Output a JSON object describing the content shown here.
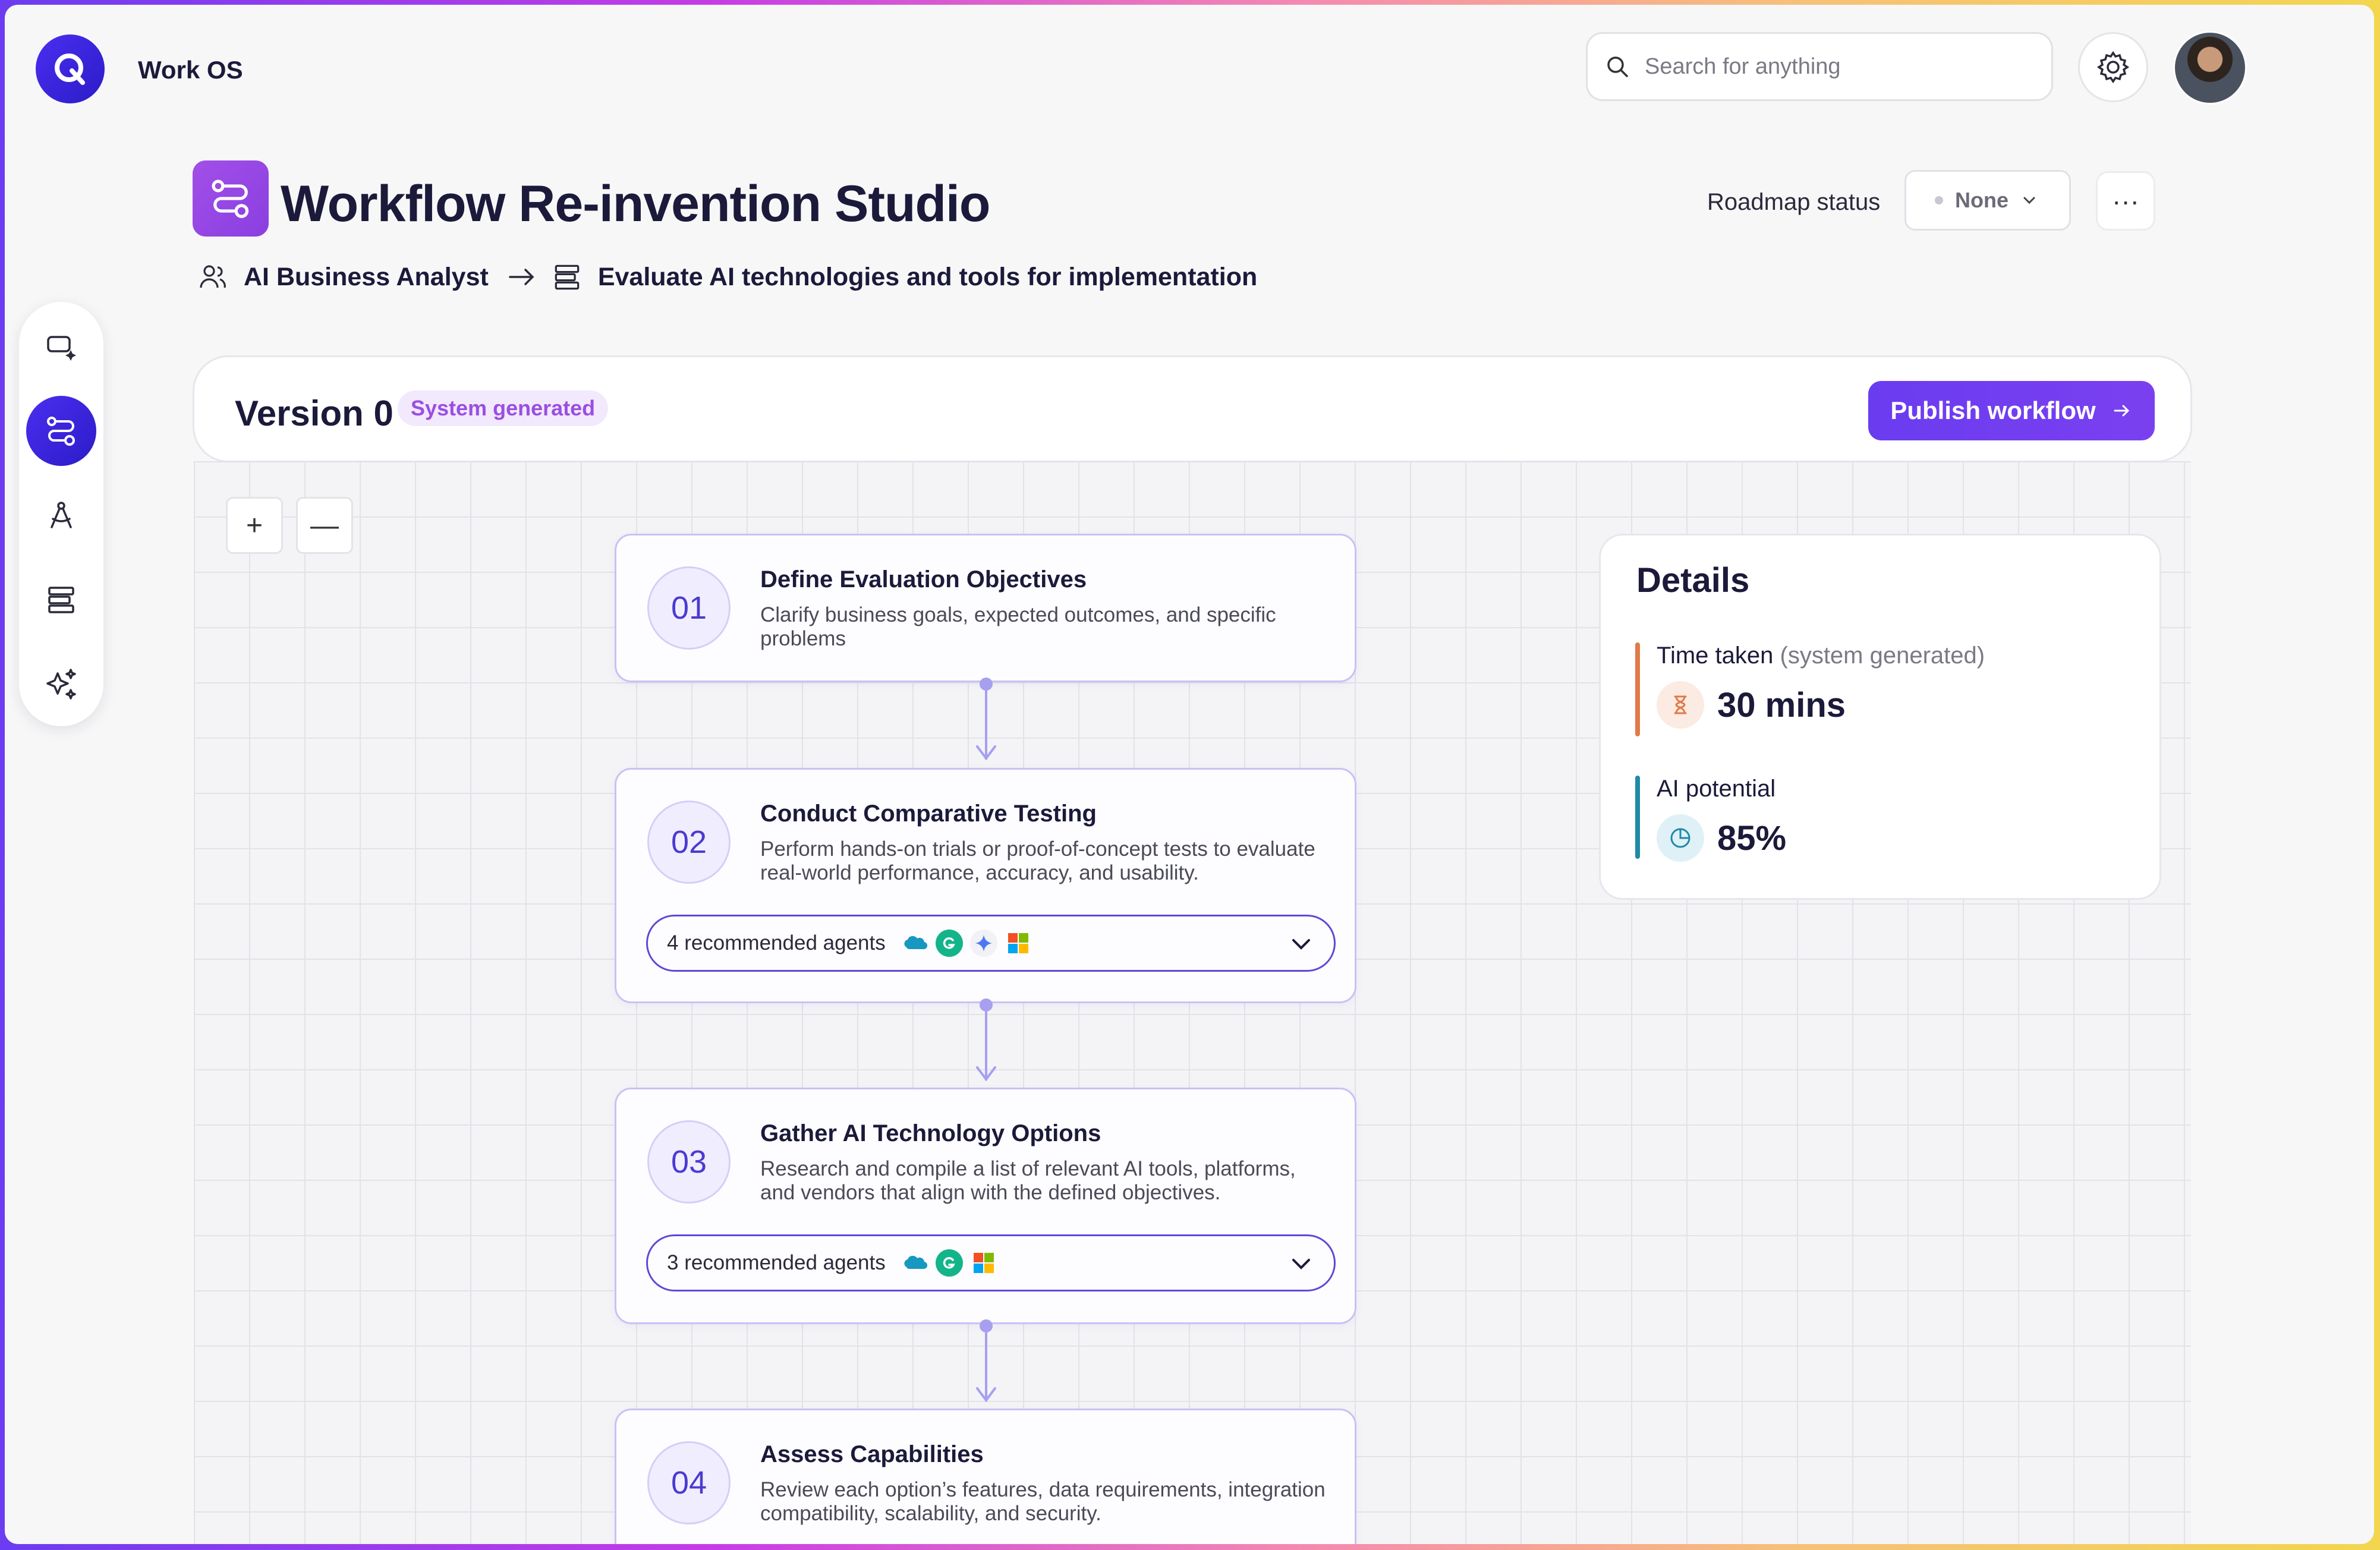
{
  "app": {
    "name": "Work OS"
  },
  "search": {
    "placeholder": "Search for anything"
  },
  "page": {
    "title": "Workflow Re-invention Studio",
    "roadmap_label": "Roadmap status",
    "roadmap_value": "None",
    "more_label": "···"
  },
  "breadcrumb": {
    "role": "AI Business Analyst",
    "task": "Evaluate AI technologies and tools for implementation"
  },
  "version": {
    "title": "Version 0",
    "badge": "System generated",
    "publish_label": "Publish workflow"
  },
  "zoom": {
    "in": "+",
    "out": "—"
  },
  "steps": [
    {
      "number": "01",
      "title": "Define Evaluation Objectives",
      "description": "Clarify business goals, expected outcomes, and specific problems"
    },
    {
      "number": "02",
      "title": "Conduct Comparative Testing",
      "description": "Perform hands-on trials or proof-of-concept tests to evaluate real-world performance, accuracy, and usability.",
      "agents_label": "4 recommended agents",
      "agent_icons": [
        "salesforce-icon",
        "grammarly-icon",
        "gemini-icon",
        "microsoft-icon"
      ]
    },
    {
      "number": "03",
      "title": "Gather AI Technology Options",
      "description": "Research and compile a list of relevant AI tools, platforms, and vendors that align with the defined objectives.",
      "agents_label": "3 recommended agents",
      "agent_icons": [
        "salesforce-icon",
        "grammarly-icon",
        "microsoft-icon"
      ]
    },
    {
      "number": "04",
      "title": "Assess Capabilities",
      "description": "Review each option’s features, data requirements, integration compatibility, scalability, and security."
    }
  ],
  "details": {
    "title": "Details",
    "time_label": "Time taken",
    "time_sub": "(system generated)",
    "time_value": "30 mins",
    "ai_label": "AI potential",
    "ai_value": "85%"
  },
  "colors": {
    "accent": "#6a3cf0",
    "time_bar": "#e07a4a",
    "ai_bar": "#1f8aa8"
  }
}
